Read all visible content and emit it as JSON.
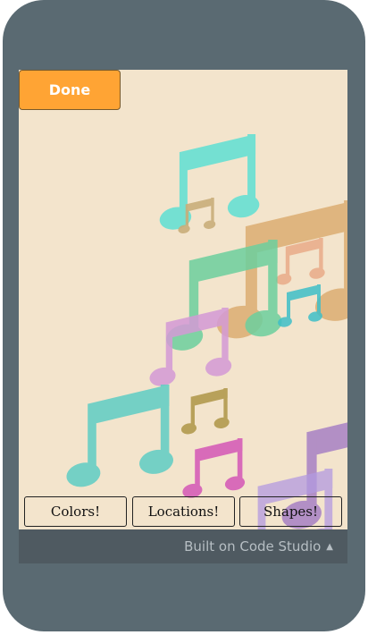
{
  "app": {
    "done_label": "Done",
    "footer_text": "Built on Code Studio",
    "footer_caret": "▲"
  },
  "buttons": {
    "colors": "Colors!",
    "locations": "Locations!",
    "shapes": "Shapes!"
  },
  "theme": {
    "frame_color": "#5a6a72",
    "screen_bg": "#f3e4cc",
    "done_color": "#ffa434",
    "footer_bg": "#4f5a61"
  },
  "icons": {
    "music_note": "beamed-eighth-notes-icon"
  }
}
